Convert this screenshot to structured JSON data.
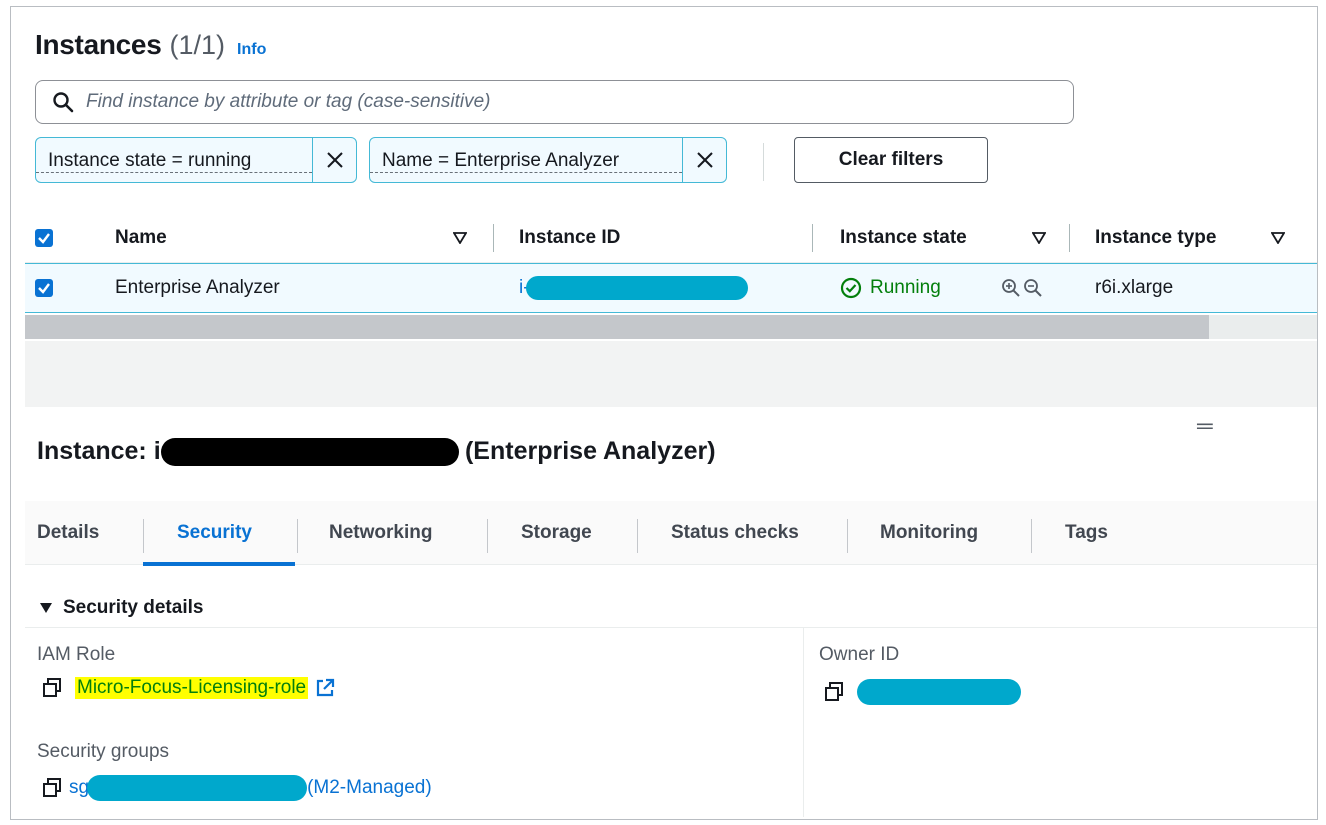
{
  "header": {
    "title": "Instances",
    "count": "(1/1)",
    "info": "Info"
  },
  "search": {
    "placeholder": "Find instance by attribute or tag (case-sensitive)"
  },
  "filters": [
    {
      "label": "Instance state = running"
    },
    {
      "label": "Name = Enterprise Analyzer"
    }
  ],
  "clear_filters": "Clear filters",
  "table": {
    "columns": [
      "Name",
      "Instance ID",
      "Instance state",
      "Instance type"
    ],
    "rows": [
      {
        "selected": true,
        "name": "Enterprise Analyzer",
        "instance_id_prefix": "i-",
        "state": "Running",
        "type": "r6i.xlarge"
      }
    ]
  },
  "detail": {
    "title_prefix": "Instance: i-",
    "title_suffix": "(Enterprise Analyzer)",
    "tabs": [
      "Details",
      "Security",
      "Networking",
      "Storage",
      "Status checks",
      "Monitoring",
      "Tags"
    ],
    "active_tab": "Security",
    "section": "Security details",
    "iam_role_label": "IAM Role",
    "iam_role_value": "Micro-Focus-Licensing-role",
    "owner_id_label": "Owner ID",
    "security_groups_label": "Security groups",
    "security_group_prefix": "sg",
    "security_group_suffix": "(M2-Managed)"
  },
  "colors": {
    "link": "#0972d3",
    "running": "#037f0c",
    "redaction_blue": "#00a8cc",
    "highlight": "#ffff00"
  }
}
